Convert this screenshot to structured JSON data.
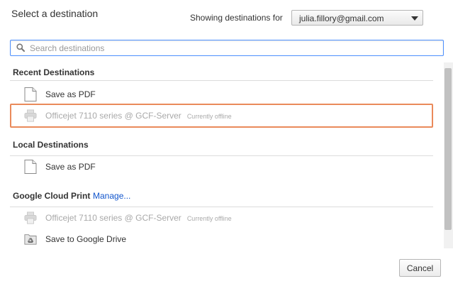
{
  "dialog": {
    "title": "Select a destination",
    "account_label": "Showing destinations for",
    "account_value": "julia.fillory@gmail.com"
  },
  "search": {
    "placeholder": "Search destinations",
    "value": ""
  },
  "sections": {
    "recent": {
      "header": "Recent Destinations",
      "items": [
        {
          "label": "Save as PDF",
          "status": "",
          "icon": "pdf-document-icon",
          "offline": false
        },
        {
          "label": "Officejet 7110 series @ GCF-Server",
          "status": "Currently offline",
          "icon": "printer-icon",
          "offline": true,
          "highlighted": true
        }
      ]
    },
    "local": {
      "header": "Local Destinations",
      "items": [
        {
          "label": "Save as PDF",
          "status": "",
          "icon": "pdf-document-icon",
          "offline": false
        }
      ]
    },
    "cloud": {
      "header": "Google Cloud Print",
      "manage_link": "Manage...",
      "items": [
        {
          "label": "Officejet 7110 series @ GCF-Server",
          "status": "Currently offline",
          "icon": "printer-icon",
          "offline": true
        },
        {
          "label": "Save to Google Drive",
          "status": "",
          "icon": "google-drive-icon",
          "offline": false
        }
      ]
    }
  },
  "footer": {
    "cancel_label": "Cancel"
  },
  "colors": {
    "highlight_border": "#ea8a5b",
    "search_focus_border": "#4d90fe",
    "link": "#1155cc",
    "offline_text": "#a9a9a9"
  }
}
